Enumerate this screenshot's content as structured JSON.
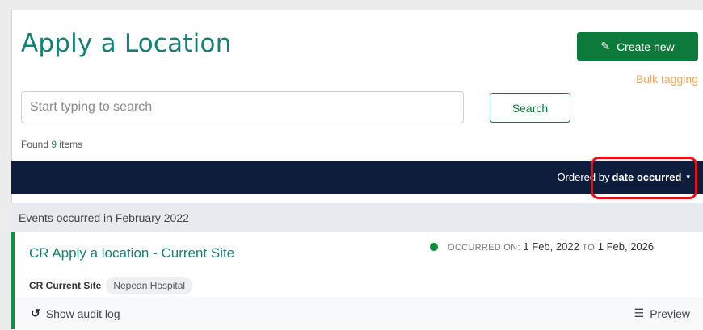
{
  "header": {
    "title": "Apply a Location",
    "create_button_label": "Create new",
    "bulk_tagging_label": "Bulk tagging"
  },
  "search": {
    "placeholder": "Start typing to search",
    "value": "",
    "button_label": "Search"
  },
  "results": {
    "found_prefix": "Found",
    "count": "9",
    "found_suffix": "items"
  },
  "ordering": {
    "prefix": "Ordered by",
    "field": "date occurred",
    "caret": "▾"
  },
  "group": {
    "label": "Events occurred in February 2022"
  },
  "event": {
    "title": "CR Apply a location - Current Site",
    "status_color": "#138a3a",
    "occurred_label": "OCCURRED ON:",
    "start_date": "1 Feb, 2022",
    "to_label": "TO",
    "end_date": "1 Feb, 2026",
    "site_name": "CR Current Site",
    "site_tag": "Nepean Hospital",
    "audit_label": "Show audit log",
    "preview_label": "Preview"
  },
  "icons": {
    "create": "edit-icon",
    "audit": "history-icon",
    "preview": "list-icon"
  },
  "colors": {
    "brand_green": "#0b7a3a",
    "title_teal": "#177f74",
    "navy_bar": "#0e1d3b",
    "bulk_orange": "#f0a95a",
    "highlight_red": "#e8111b"
  }
}
